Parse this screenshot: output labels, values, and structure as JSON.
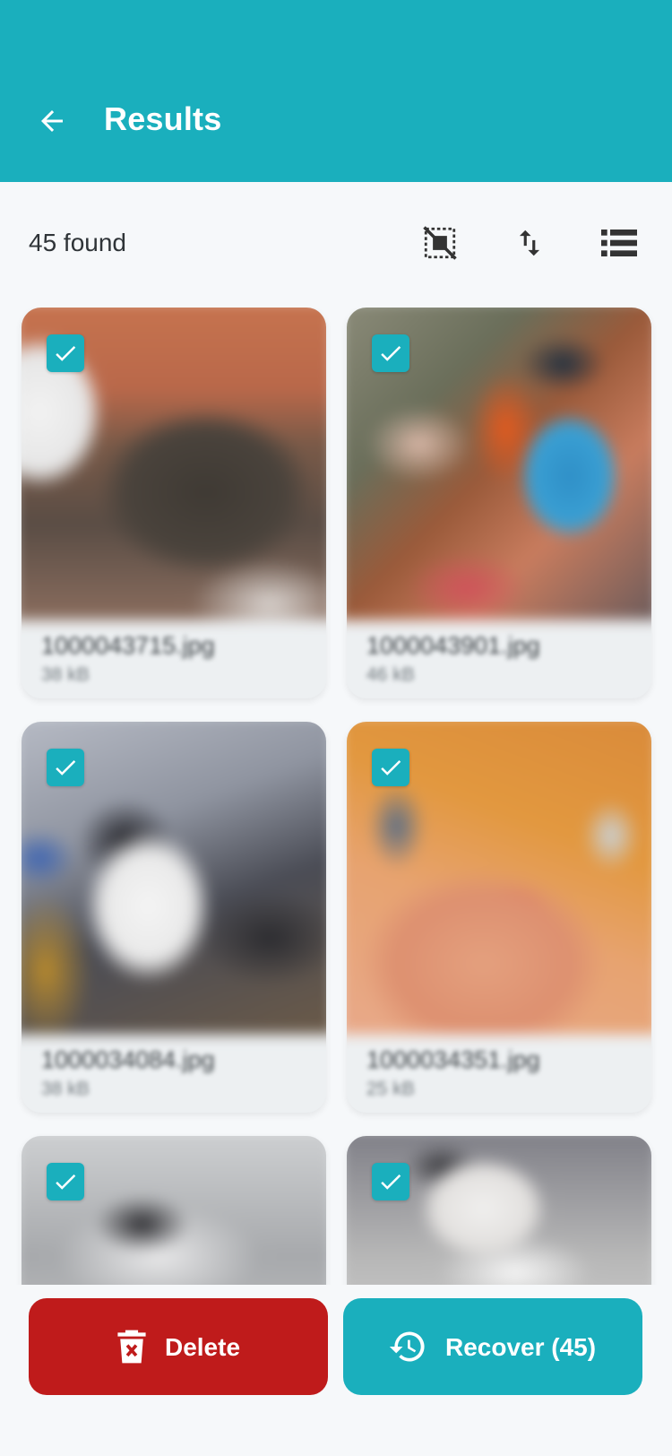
{
  "app_bar": {
    "title": "Results",
    "back_icon": "arrow-left-icon",
    "color": "#1aafbd"
  },
  "toolbar": {
    "found_label": "45 found",
    "icons": [
      "deselect-all-icon",
      "sort-icon",
      "list-view-icon"
    ]
  },
  "results": [
    {
      "name": "1000043715.jpg",
      "size": "38 kB",
      "selected": true
    },
    {
      "name": "1000043901.jpg",
      "size": "46 kB",
      "selected": true
    },
    {
      "name": "1000034084.jpg",
      "size": "38 kB",
      "selected": true
    },
    {
      "name": "1000034351.jpg",
      "size": "25 kB",
      "selected": true
    },
    {
      "selected": true
    },
    {
      "selected": true
    }
  ],
  "actions": {
    "delete_label": "Delete",
    "recover_label": "Recover (45)",
    "delete_color": "#bf1b1b",
    "recover_color": "#1aafbd"
  }
}
